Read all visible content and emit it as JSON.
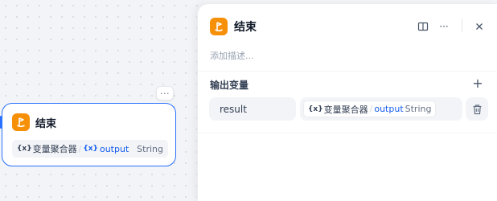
{
  "node": {
    "title": "结束",
    "more_label": "···",
    "variable": {
      "icon": "{x}",
      "source": "变量聚合器",
      "separator": "/",
      "out_icon": "{x}",
      "name": "output",
      "type": "String"
    }
  },
  "panel": {
    "title": "结束",
    "description_placeholder": "添加描述...",
    "more_label": "···",
    "section_title": "输出变量",
    "add_label": "+",
    "output_row": {
      "name": "result",
      "icon": "{x}",
      "source": "变量聚合器",
      "separator": "/",
      "var": "output",
      "type": "String"
    }
  },
  "colors": {
    "accent": "#2970ff",
    "node_icon_bg": "#f79009",
    "link": "#155eef"
  }
}
